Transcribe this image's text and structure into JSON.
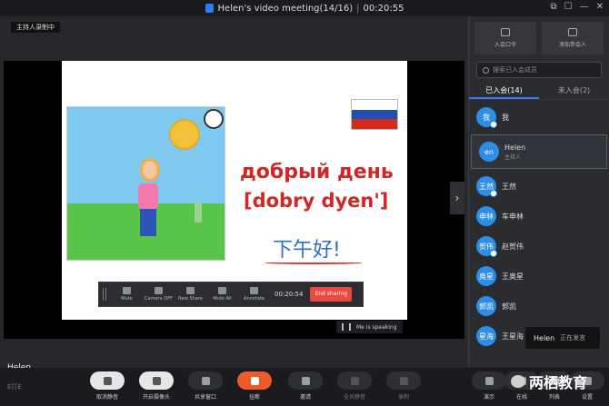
{
  "window": {
    "title": "Helen's video meeting(14/16)",
    "timer": "00:20:55",
    "controls": [
      "⧉",
      "☐",
      "—",
      "✕"
    ]
  },
  "stage": {
    "recording_badge": "主持人录制中",
    "speaker_name": "Helen",
    "slide": {
      "russian_line1": "добрый день",
      "russian_line2": "[dobry dyen']",
      "chinese_text": "下午好!",
      "flag_colors": [
        "#ffffff",
        "#1f4fb4",
        "#d52b1e"
      ]
    },
    "share_toolbar": {
      "items": [
        "Mute",
        "Camera OFF",
        "New Share",
        "Mute All",
        "Annotate"
      ],
      "time": "00:20:54",
      "stop_label": "End sharing"
    },
    "speaking_tag": "Me is speaking"
  },
  "panel": {
    "buttons": [
      {
        "label": "入会口令"
      },
      {
        "label": "添加参会人"
      }
    ],
    "search_placeholder": "搜索已入会成员",
    "tabs": [
      {
        "label": "已入会(14)",
        "active": true
      },
      {
        "label": "未入会(2)",
        "active": false
      }
    ],
    "members": [
      {
        "avatar": "我",
        "name": "我",
        "role": "",
        "host": false
      },
      {
        "avatar": "en",
        "name": "Helen",
        "role": "主持人",
        "host": true
      },
      {
        "avatar": "王然",
        "name": "王然",
        "role": "",
        "host": false
      },
      {
        "avatar": "申林",
        "name": "车申林",
        "role": "",
        "host": false
      },
      {
        "avatar": "贺伟",
        "name": "赵贺伟",
        "role": "",
        "host": false
      },
      {
        "avatar": "奥星",
        "name": "王奥星",
        "role": "",
        "host": false
      },
      {
        "avatar": "郭凯",
        "name": "郭凯",
        "role": "",
        "host": false
      },
      {
        "avatar": "星海",
        "name": "王星海",
        "role": "",
        "host": false
      }
    ],
    "speaking_popup": {
      "name": "Helen",
      "status": "正在发言"
    }
  },
  "toolbar": {
    "brand": "E打E",
    "buttons": [
      {
        "label": "取消静音",
        "style": "light"
      },
      {
        "label": "开启摄像头",
        "style": "light"
      },
      {
        "label": "共享窗口",
        "style": "dark"
      },
      {
        "label": "挂断",
        "style": "red"
      },
      {
        "label": "邀请",
        "style": "dark"
      },
      {
        "label": "全员静音",
        "style": "dim"
      },
      {
        "label": "录制",
        "style": "dim"
      }
    ],
    "right_buttons": [
      "演示",
      "在线",
      "列表",
      "设置"
    ],
    "watermark": "两栖教育"
  }
}
